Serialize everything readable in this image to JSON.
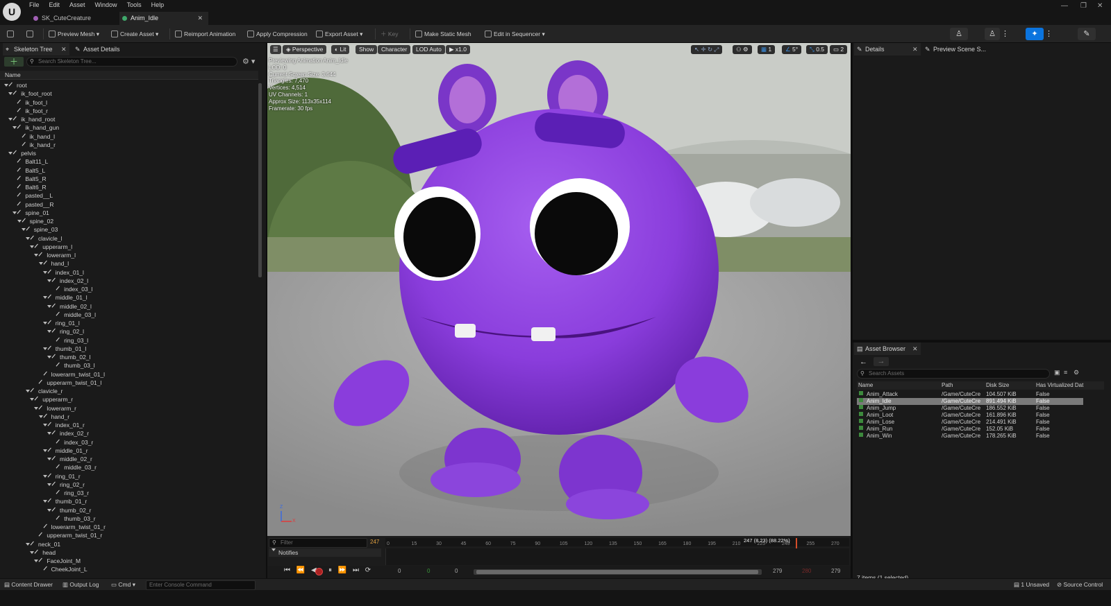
{
  "menu": [
    "File",
    "Edit",
    "Asset",
    "Window",
    "Tools",
    "Help"
  ],
  "doc_tabs": [
    {
      "label": "SK_CuteCreature"
    },
    {
      "label": "Anim_Idle"
    }
  ],
  "toolbar": {
    "preview_mesh": "Preview Mesh",
    "create_asset": "Create Asset",
    "reimport": "Reimport Animation",
    "apply_compression": "Apply Compression",
    "export_asset": "Export Asset",
    "key": "Key",
    "make_static_mesh": "Make Static Mesh",
    "edit_in_sequencer": "Edit in Sequencer"
  },
  "left_panel": {
    "tab_skeleton": "Skeleton Tree",
    "tab_asset_details": "Asset Details",
    "search_placeholder": "Search Skeleton Tree...",
    "column_name": "Name",
    "bones": [
      {
        "name": "root",
        "d": 0
      },
      {
        "name": "ik_foot_root",
        "d": 1
      },
      {
        "name": "ik_foot_l",
        "d": 2
      },
      {
        "name": "ik_foot_r",
        "d": 2
      },
      {
        "name": "ik_hand_root",
        "d": 1
      },
      {
        "name": "ik_hand_gun",
        "d": 2
      },
      {
        "name": "ik_hand_l",
        "d": 3
      },
      {
        "name": "ik_hand_r",
        "d": 3
      },
      {
        "name": "pelvis",
        "d": 1
      },
      {
        "name": "Balt11_L",
        "d": 2
      },
      {
        "name": "Balt5_L",
        "d": 2
      },
      {
        "name": "Balt5_R",
        "d": 2
      },
      {
        "name": "Balt6_R",
        "d": 2
      },
      {
        "name": "pasted__L",
        "d": 2
      },
      {
        "name": "pasted__R",
        "d": 2
      },
      {
        "name": "spine_01",
        "d": 2
      },
      {
        "name": "spine_02",
        "d": 3
      },
      {
        "name": "spine_03",
        "d": 4
      },
      {
        "name": "clavicle_l",
        "d": 5
      },
      {
        "name": "upperarm_l",
        "d": 6
      },
      {
        "name": "lowerarm_l",
        "d": 7
      },
      {
        "name": "hand_l",
        "d": 8
      },
      {
        "name": "index_01_l",
        "d": 9
      },
      {
        "name": "index_02_l",
        "d": 10
      },
      {
        "name": "index_03_l",
        "d": 11
      },
      {
        "name": "middle_01_l",
        "d": 9
      },
      {
        "name": "middle_02_l",
        "d": 10
      },
      {
        "name": "middle_03_l",
        "d": 11
      },
      {
        "name": "ring_01_l",
        "d": 9
      },
      {
        "name": "ring_02_l",
        "d": 10
      },
      {
        "name": "ring_03_l",
        "d": 11
      },
      {
        "name": "thumb_01_l",
        "d": 9
      },
      {
        "name": "thumb_02_l",
        "d": 10
      },
      {
        "name": "thumb_03_l",
        "d": 11
      },
      {
        "name": "lowerarm_twist_01_l",
        "d": 8
      },
      {
        "name": "upperarm_twist_01_l",
        "d": 7
      },
      {
        "name": "clavicle_r",
        "d": 5
      },
      {
        "name": "upperarm_r",
        "d": 6
      },
      {
        "name": "lowerarm_r",
        "d": 7
      },
      {
        "name": "hand_r",
        "d": 8
      },
      {
        "name": "index_01_r",
        "d": 9
      },
      {
        "name": "index_02_r",
        "d": 10
      },
      {
        "name": "index_03_r",
        "d": 11
      },
      {
        "name": "middle_01_r",
        "d": 9
      },
      {
        "name": "middle_02_r",
        "d": 10
      },
      {
        "name": "middle_03_r",
        "d": 11
      },
      {
        "name": "ring_01_r",
        "d": 9
      },
      {
        "name": "ring_02_r",
        "d": 10
      },
      {
        "name": "ring_03_r",
        "d": 11
      },
      {
        "name": "thumb_01_r",
        "d": 9
      },
      {
        "name": "thumb_02_r",
        "d": 10
      },
      {
        "name": "thumb_03_r",
        "d": 11
      },
      {
        "name": "lowerarm_twist_01_r",
        "d": 8
      },
      {
        "name": "upperarm_twist_01_r",
        "d": 7
      },
      {
        "name": "neck_01",
        "d": 5
      },
      {
        "name": "head",
        "d": 6
      },
      {
        "name": "FaceJoint_M",
        "d": 7
      },
      {
        "name": "CheekJoint_L",
        "d": 8
      }
    ]
  },
  "viewport": {
    "perspective": "Perspective",
    "lit": "Lit",
    "show": "Show",
    "character": "Character",
    "lod": "LOD Auto",
    "speed": "x1.0",
    "stats": [
      "Previewing Animation Anim_Idle",
      "LOD: 0",
      "Current Screen Size: 3.644",
      "Triangles: 7,470",
      "Vertices: 4,514",
      "UV Channels: 1",
      "Approx Size: 113x35x114",
      "Framerate: 30 fps"
    ],
    "grid_value": "1",
    "angle_value": "5°",
    "scale_value": "0.5",
    "camera_value": "2",
    "axis_z": "Z",
    "axis_x": "X"
  },
  "timeline": {
    "filter_placeholder": "Filter",
    "frame_badge": "247",
    "playhead_label": "247 (8.23) (88.22%)",
    "ticks": [
      "0",
      "15",
      "30",
      "45",
      "60",
      "75",
      "90",
      "105",
      "120",
      "135",
      "150",
      "165",
      "180",
      "195",
      "210",
      "225",
      "240",
      "255",
      "270"
    ],
    "notifies": "Notifies",
    "range_start": "0",
    "range_start2": "0",
    "range_mid": "0",
    "range_end": "279",
    "range_end2": "279",
    "range_red": "280"
  },
  "details": {
    "tab_details": "Details",
    "tab_preview": "Preview Scene S..."
  },
  "asset_browser": {
    "tab": "Asset Browser",
    "search_placeholder": "Search Assets",
    "columns": [
      "Name",
      "Path",
      "Disk Size",
      "Has Virtualized Dat"
    ],
    "rows": [
      {
        "name": "Anim_Attack",
        "path": "/Game/CuteCre",
        "size": "104.507 KiB",
        "virt": "False"
      },
      {
        "name": "Anim_Idle",
        "path": "/Game/CuteCre",
        "size": "891.494 KiB",
        "virt": "False",
        "selected": true
      },
      {
        "name": "Anim_Jump",
        "path": "/Game/CuteCre",
        "size": "186.552 KiB",
        "virt": "False"
      },
      {
        "name": "Anim_Loot",
        "path": "/Game/CuteCre",
        "size": "161.896 KiB",
        "virt": "False"
      },
      {
        "name": "Anim_Lose",
        "path": "/Game/CuteCre",
        "size": "214.491 KiB",
        "virt": "False"
      },
      {
        "name": "Anim_Run",
        "path": "/Game/CuteCre",
        "size": "152.05 KiB",
        "virt": "False"
      },
      {
        "name": "Anim_Win",
        "path": "/Game/CuteCre",
        "size": "178.265 KiB",
        "virt": "False"
      }
    ],
    "footer": "7 items (1 selected)"
  },
  "statusbar": {
    "content_drawer": "Content Drawer",
    "output_log": "Output Log",
    "cmd": "Cmd",
    "console_placeholder": "Enter Console Command",
    "unsaved": "1 Unsaved",
    "source_control": "Source Control"
  },
  "colors": {
    "accent": "#0b74de",
    "creature": "#8b3fd6",
    "selection": "#7a7a7a"
  },
  "playback_progress": 0.885
}
